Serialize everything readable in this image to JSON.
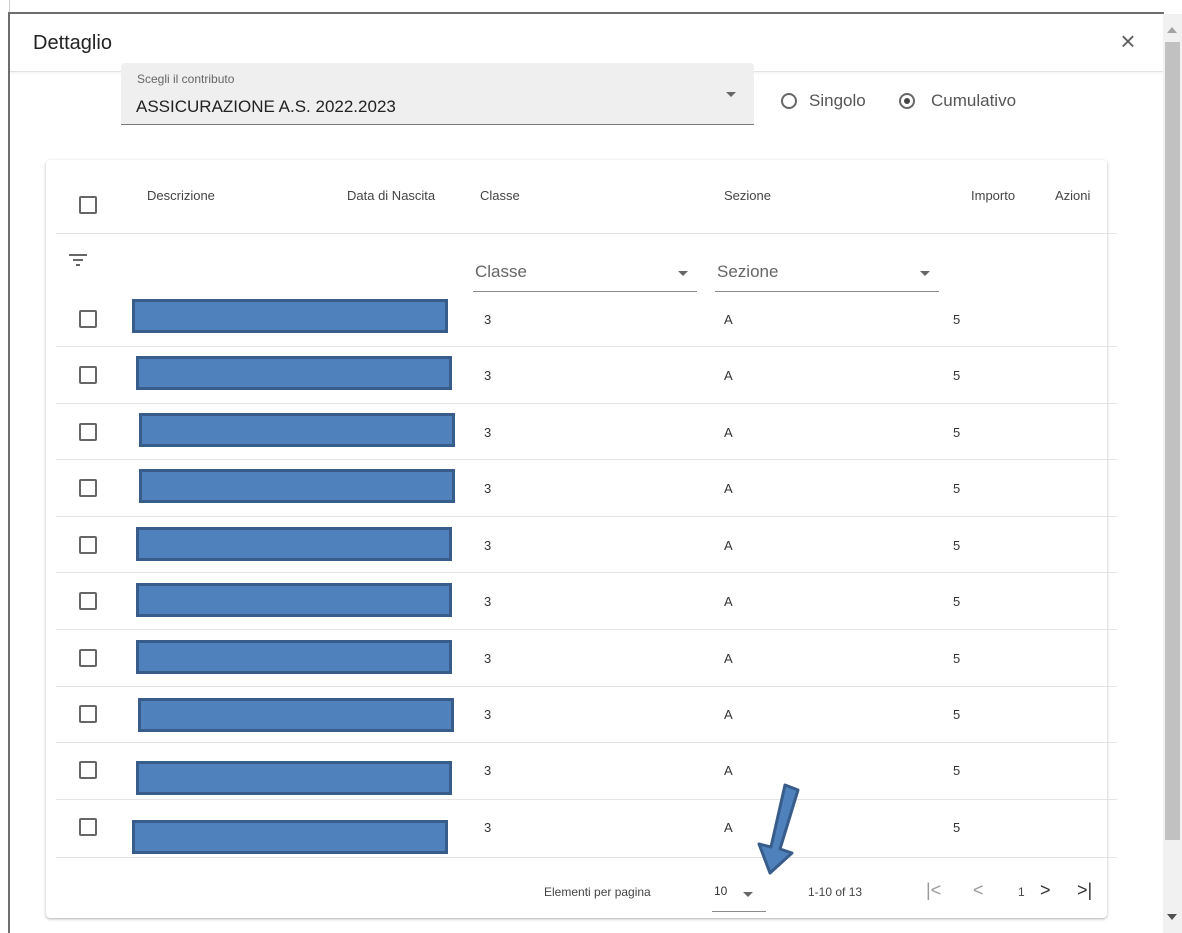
{
  "dialog": {
    "title": "Dettaglio",
    "close_symbol": "×"
  },
  "contribution_select": {
    "label": "Scegli il contributo",
    "value": "ASSICURAZIONE A.S. 2022.2023"
  },
  "mode_radio": {
    "options": [
      {
        "label": "Singolo",
        "checked": false
      },
      {
        "label": "Cumulativo",
        "checked": true
      }
    ]
  },
  "table": {
    "columns": {
      "descrizione": "Descrizione",
      "data_nascita": "Data di Nascita",
      "classe": "Classe",
      "sezione": "Sezione",
      "importo": "Importo",
      "azioni": "Azioni"
    },
    "filters": {
      "classe_placeholder": "Classe",
      "sezione_placeholder": "Sezione"
    },
    "rows": [
      {
        "classe": "3",
        "sezione": "A",
        "importo": "5"
      },
      {
        "classe": "3",
        "sezione": "A",
        "importo": "5"
      },
      {
        "classe": "3",
        "sezione": "A",
        "importo": "5"
      },
      {
        "classe": "3",
        "sezione": "A",
        "importo": "5"
      },
      {
        "classe": "3",
        "sezione": "A",
        "importo": "5"
      },
      {
        "classe": "3",
        "sezione": "A",
        "importo": "5"
      },
      {
        "classe": "3",
        "sezione": "A",
        "importo": "5"
      },
      {
        "classe": "3",
        "sezione": "A",
        "importo": "5"
      },
      {
        "classe": "3",
        "sezione": "A",
        "importo": "5"
      },
      {
        "classe": "3",
        "sezione": "A",
        "importo": "5"
      }
    ]
  },
  "paginator": {
    "items_per_page_label": "Elementi per pagina",
    "page_size": "10",
    "range_label": "1-10 of 13",
    "current_page": "1",
    "first_symbol": "|<",
    "prev_symbol": "<",
    "next_symbol": ">",
    "last_symbol": ">|"
  },
  "colors": {
    "redaction_fill": "#4f81bd",
    "redaction_border": "#385d8a"
  }
}
